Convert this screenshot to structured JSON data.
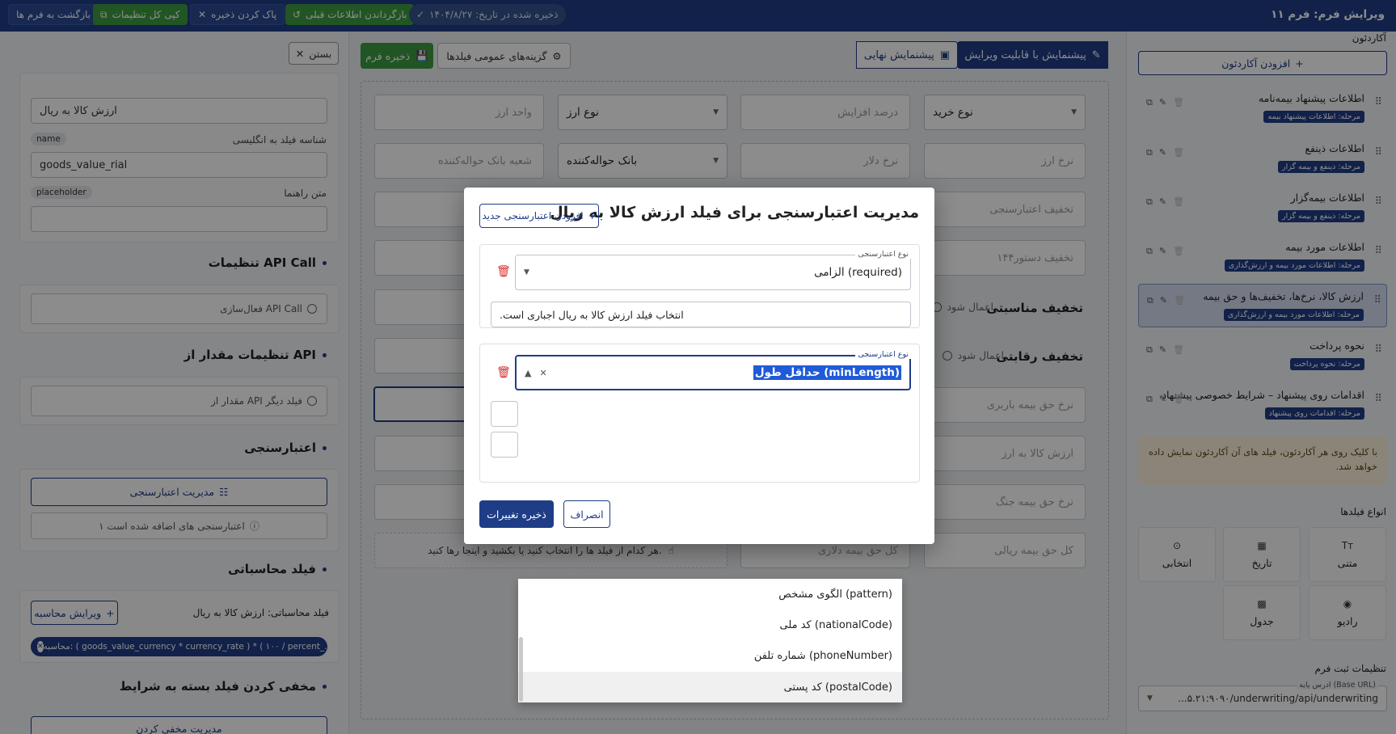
{
  "topbar": {
    "title": "ویرایش فرم: فرم ۱۱",
    "back_label": "بازگشت به فرم ها",
    "copy_settings_label": "کپی کل تنظیمات",
    "clear_save_label": "پاک کردن ذخیره",
    "restore_label": "بازگرداندن اطلاعات قبلی",
    "saved_label": "ذخیره شده در تاریخ: ۱۴۰۴/۸/۲۷"
  },
  "left": {
    "close_label": "بستن",
    "label_value": "ارزش کالا به ریال",
    "english_id_label": "شناسه فیلد به انگلیسی",
    "name_chip": "name",
    "name_value": "goods_value_rial",
    "hint_label": "متن راهنما",
    "placeholder_chip": "placeholder",
    "placeholder_value": "",
    "api_call_title": "تنظیمات API Call",
    "api_call_enable": "فعال‌سازی API Call",
    "api_value_title": "تنظیمات مقدار از API",
    "api_value_option": "مقدار از API فیلد دیگر",
    "validation_title": "اعتبارسنجی",
    "manage_validation_label": "مدیریت اعتبارسنجی",
    "validation_count_label": "۱ اعتبارسنجی های اضافه شده است",
    "computed_title": "فیلد محاسباتی",
    "computed_label": "فیلد محاسباتی: ارزش کالا به ریال",
    "edit_calc_label": "ویرایش محاسبه",
    "calc_formula": "محاسبه: ( goods_value_currency * currency_rate ) * ( ۱۰۰ / percent_...",
    "hide_title": "مخفی کردن فیلد بسته به شرایط",
    "hide_button_label": "مدیریت مخفی کردن"
  },
  "center": {
    "editable_preview_tab": "پیشنمایش با قابلیت ویرایش",
    "final_preview_tab": "پیشنمایش نهایی",
    "general_options_label": "گزینه‌های عمومی فیلدها",
    "save_form_label": "ذخیره فرم",
    "fields": {
      "purchase_type": "نوع خرید",
      "increase_percent": "درصد افزایش",
      "currency_type": "نوع ارز",
      "currency_unit": "واحد ارز",
      "currency_rate": "نرخ ارز",
      "dollar_rate": "نرخ دلار",
      "remit_bank": "بانک حواله‌کننده",
      "remit_branch": "شعبه بانک حواله‌کننده",
      "validation_discount": "تخفیف اعتبارسنجی",
      "discount_144": "تخفیف دستور۱۴۴",
      "suitability_discount": "تخفیف مناسبتی",
      "competitive_discount": "تخفیف رقابتی",
      "apply_option": "اعمال شود",
      "cargo_premium": "نرخ حق بیمه باربری",
      "goods_value_currency": "ارزش کالا به ارز",
      "war_premium": "نرخ حق بیمه جنگ",
      "total_rial": "کل حق بیمه ریالی",
      "total_dollar": "کل حق بیمه دلاری",
      "drag_hint": "هر کدام از فیلد ها را انتخاب کنید یا بکشید و اینجا رها کنید."
    }
  },
  "right": {
    "accordion_title": "آکاردئون",
    "add_accordion_label": "افزودن آکاردئون",
    "items": [
      {
        "title": "اطلاعات پیشنهاد بیمه‌نامه",
        "badge": "مرحله: اطلاعات پیشنهاد بیمه"
      },
      {
        "title": "اطلاعات ذینفع",
        "badge": "مرحله: ذینفع و بیمه گزار"
      },
      {
        "title": "اطلاعات بیمه‌گزار",
        "badge": "مرحله: ذینفع و بیمه گزار"
      },
      {
        "title": "اطلاعات مورد بیمه",
        "badge": "مرحله: اطلاعات مورد بیمه و ارزش‌گذاری"
      },
      {
        "title": "ارزش کالا، نرخ‌ها، تخفیف‌ها و حق بیمه",
        "badge": "مرحله: اطلاعات مورد بیمه و ارزش‌گذاری"
      },
      {
        "title": "نحوه پرداخت",
        "badge": "مرحله: نحوه پرداخت"
      },
      {
        "title": "اقدامات روی پیشنهاد – شرایط خصوصی پیشنهاد",
        "badge": "مرحله: اقدامات روی پیشنهاد"
      }
    ],
    "info_note": "با کلیک روی هر آکاردئون، فیلد های آن آکاردئون نمایش داده خواهد شد.",
    "field_types_title": "انواع فیلدها",
    "field_types": [
      {
        "label": "متنی",
        "icon": "Tт"
      },
      {
        "label": "تاریخ",
        "icon": "▦"
      },
      {
        "label": "انتخابی",
        "icon": "⊙"
      },
      {
        "label": "رادیو",
        "icon": "◉"
      },
      {
        "label": "جدول",
        "icon": "▩"
      }
    ],
    "register_settings_title": "تنظیمات ثبت فرم",
    "base_url_label": "ادرس پایه (Base URL)",
    "base_url_value": "...۵.۲۱:۹۰۹۰/underwriting/api/underwriting"
  },
  "modal": {
    "title": "مدیریت اعتبارسنجی برای فیلد ارزش کالا به ریال",
    "add_new_label": "افزودن اعتبارسنجی جدید",
    "type_label": "نوع اعتبارسنجی",
    "rule1_value": "الزامی (required)",
    "rule1_message": "انتخاب فیلد ارزش کالا به ریال اجباری است.",
    "rule2_value": "حداقل طول (minLength)",
    "save_label": "ذخیره تغییرات",
    "cancel_label": "انصراف",
    "options": [
      "الگوی مشخص (pattern)",
      "کد ملی (nationalCode)",
      "شماره تلفن (phoneNumber)",
      "کد پستی (postalCode)"
    ]
  }
}
